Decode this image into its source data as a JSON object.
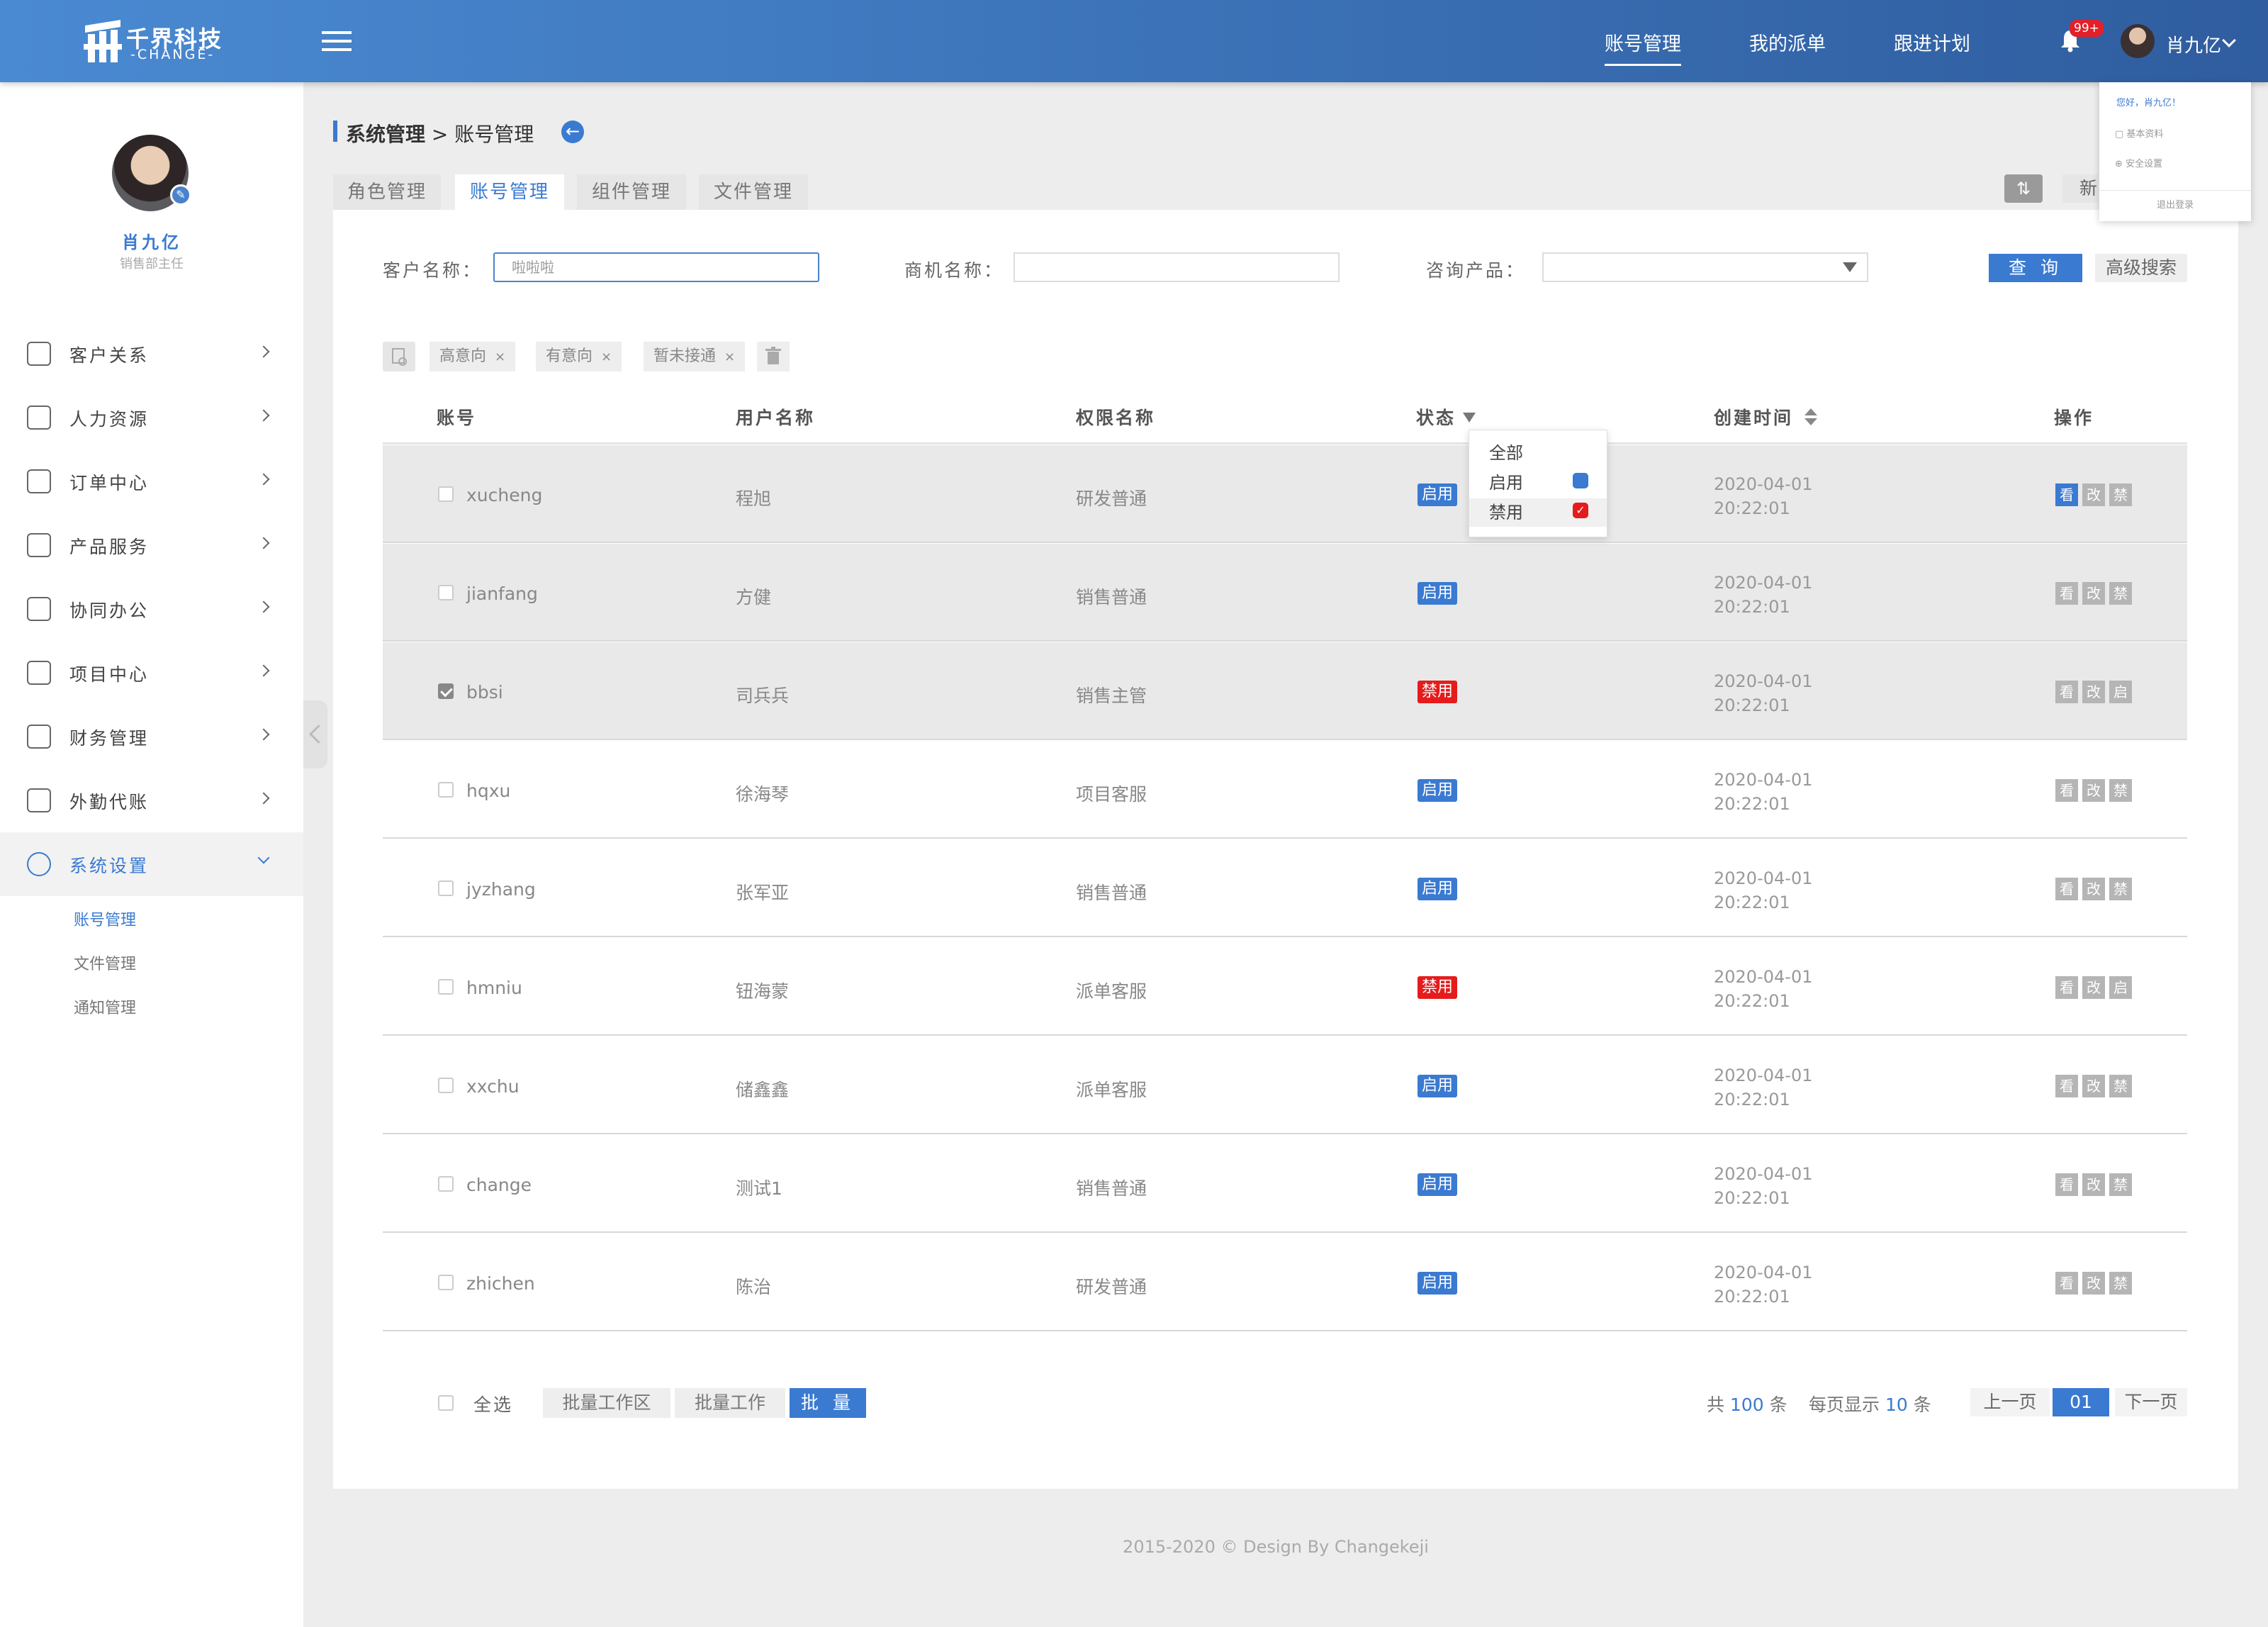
{
  "header": {
    "brand_name": "千界科技",
    "brand_sub": "-CHANGE-",
    "nav": [
      "账号管理",
      "我的派单",
      "跟进计划"
    ],
    "notification_count": "99+",
    "user_name": "肖九亿"
  },
  "user_menu": {
    "greeting": "您好，肖九亿！",
    "items": [
      "基本资料",
      "安全设置"
    ],
    "logout": "退出登录"
  },
  "sidebar": {
    "name": "肖九亿",
    "role": "销售部主任",
    "items": [
      {
        "label": "客户关系",
        "icon": "users-icon"
      },
      {
        "label": "人力资源",
        "icon": "person-icon"
      },
      {
        "label": "订单中心",
        "icon": "clipboard-icon"
      },
      {
        "label": "产品服务",
        "icon": "shield-heart-icon"
      },
      {
        "label": "协同办公",
        "icon": "blocks-icon"
      },
      {
        "label": "项目中心",
        "icon": "layers-icon"
      },
      {
        "label": "财务管理",
        "icon": "money-bag-icon"
      },
      {
        "label": "外勤代账",
        "icon": "car-icon"
      },
      {
        "label": "系统设置",
        "icon": "gear-icon"
      }
    ],
    "subitems": [
      "账号管理",
      "文件管理",
      "通知管理"
    ]
  },
  "breadcrumb": {
    "section": "系统管理",
    "sep": ">",
    "page": "账号管理"
  },
  "tabs": [
    "角色管理",
    "账号管理",
    "组件管理",
    "文件管理"
  ],
  "new_button": "新",
  "filters": {
    "customer_label": "客户名称：",
    "customer_value": "啦啦啦",
    "opportunity_label": "商机名称：",
    "product_label": "咨询产品：",
    "query": "查 询",
    "advanced": "高级搜索"
  },
  "tags": [
    "高意向",
    "有意向",
    "暂未接通"
  ],
  "table": {
    "headers": [
      "账号",
      "用户名称",
      "权限名称",
      "状态",
      "创建时间",
      "操作"
    ],
    "rows": [
      {
        "account": "xucheng",
        "name": "程旭",
        "role": "研发普通",
        "status": "启用",
        "date": "2020-04-01",
        "time": "20:22:01",
        "ops": [
          "看",
          "改",
          "禁"
        ]
      },
      {
        "account": "jianfang",
        "name": "方健",
        "role": "销售普通",
        "status": "启用",
        "date": "2020-04-01",
        "time": "20:22:01",
        "ops": [
          "看",
          "改",
          "禁"
        ]
      },
      {
        "account": "bbsi",
        "name": "司兵兵",
        "role": "销售主管",
        "status": "禁用",
        "date": "2020-04-01",
        "time": "20:22:01",
        "ops": [
          "看",
          "改",
          "启"
        ]
      },
      {
        "account": "hqxu",
        "name": "徐海琴",
        "role": "项目客服",
        "status": "启用",
        "date": "2020-04-01",
        "time": "20:22:01",
        "ops": [
          "看",
          "改",
          "禁"
        ]
      },
      {
        "account": "jyzhang",
        "name": "张军亚",
        "role": "销售普通",
        "status": "启用",
        "date": "2020-04-01",
        "time": "20:22:01",
        "ops": [
          "看",
          "改",
          "禁"
        ]
      },
      {
        "account": "hmniu",
        "name": "钮海蒙",
        "role": "派单客服",
        "status": "禁用",
        "date": "2020-04-01",
        "time": "20:22:01",
        "ops": [
          "看",
          "改",
          "启"
        ]
      },
      {
        "account": "xxchu",
        "name": "储鑫鑫",
        "role": "派单客服",
        "status": "启用",
        "date": "2020-04-01",
        "time": "20:22:01",
        "ops": [
          "看",
          "改",
          "禁"
        ]
      },
      {
        "account": "change",
        "name": "测试1",
        "role": "销售普通",
        "status": "启用",
        "date": "2020-04-01",
        "time": "20:22:01",
        "ops": [
          "看",
          "改",
          "禁"
        ]
      },
      {
        "account": "zhichen",
        "name": "陈治",
        "role": "研发普通",
        "status": "启用",
        "date": "2020-04-01",
        "time": "20:22:01",
        "ops": [
          "看",
          "改",
          "禁"
        ]
      }
    ]
  },
  "status_filter": {
    "options": [
      "全部",
      "启用",
      "禁用"
    ]
  },
  "bottom": {
    "select_all": "全选",
    "batch_area": "批量工作区",
    "batch_work": "批量工作",
    "batch": "批 量"
  },
  "pagination": {
    "total_prefix": "共",
    "total": "100",
    "total_suffix": "条",
    "per_page_prefix": "每页显示",
    "per_page": "10",
    "per_page_suffix": "条",
    "prev": "上一页",
    "current": "01",
    "next": "下一页"
  },
  "footer": "2015-2020 © Design By Changekeji",
  "colors": {
    "primary": "#3a7ad1",
    "danger": "#e51c1c",
    "header_from": "#4a8ad2",
    "header_to": "#2f5d9f"
  }
}
